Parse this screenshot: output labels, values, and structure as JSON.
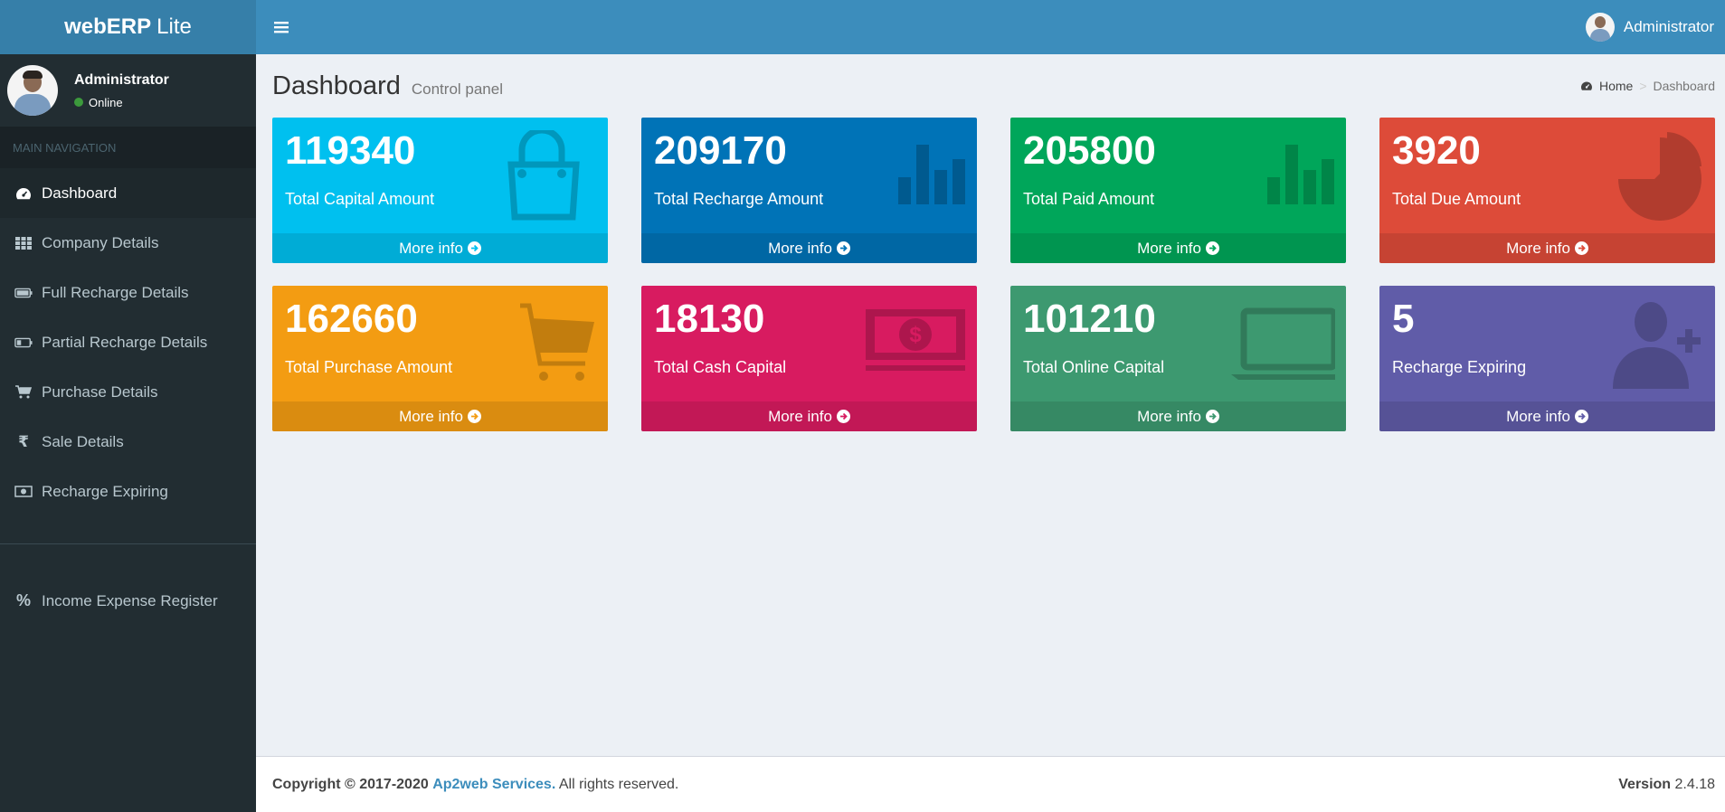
{
  "app": {
    "logo_bold": "webERP",
    "logo_light": "Lite"
  },
  "user": {
    "name": "Administrator",
    "status": "Online"
  },
  "sidebar": {
    "header": "MAIN NAVIGATION",
    "items": [
      {
        "label": "Dashboard",
        "icon": "dashboard-icon"
      },
      {
        "label": "Company Details",
        "icon": "grid-icon"
      },
      {
        "label": "Full Recharge Details",
        "icon": "battery-full-icon"
      },
      {
        "label": "Partial Recharge Details",
        "icon": "battery-partial-icon"
      },
      {
        "label": "Purchase Details",
        "icon": "cart-icon"
      },
      {
        "label": "Sale Details",
        "icon": "rupee-icon"
      },
      {
        "label": "Recharge Expiring",
        "icon": "money-icon"
      }
    ],
    "extra": {
      "label": "Income Expense Register",
      "icon": "percent-icon"
    }
  },
  "topbar": {
    "user": "Administrator"
  },
  "page": {
    "title": "Dashboard",
    "subtitle": "Control panel"
  },
  "breadcrumb": {
    "home": "Home",
    "separator": ">",
    "current": "Dashboard"
  },
  "boxes": [
    {
      "value": "119340",
      "label": "Total Capital Amount",
      "more": "More info",
      "color": "#00c0ef",
      "icon": "shopping-bag-icon"
    },
    {
      "value": "209170",
      "label": "Total Recharge Amount",
      "more": "More info",
      "color": "#0073b7",
      "icon": "bar-chart-icon"
    },
    {
      "value": "205800",
      "label": "Total Paid Amount",
      "more": "More info",
      "color": "#00a65a",
      "icon": "bar-chart-icon"
    },
    {
      "value": "3920",
      "label": "Total Due Amount",
      "more": "More info",
      "color": "#dd4b39",
      "icon": "pie-chart-icon"
    },
    {
      "value": "162660",
      "label": "Total Purchase Amount",
      "more": "More info",
      "color": "#f39c12",
      "icon": "cart-icon"
    },
    {
      "value": "18130",
      "label": "Total Cash Capital",
      "more": "More info",
      "color": "#d81b60",
      "icon": "money-icon"
    },
    {
      "value": "101210",
      "label": "Total Online Capital",
      "more": "More info",
      "color": "#3d9970",
      "icon": "laptop-icon"
    },
    {
      "value": "5",
      "label": "Recharge Expiring",
      "more": "More info",
      "color": "#605ca8",
      "icon": "user-plus-icon"
    }
  ],
  "footer": {
    "copyright": "Copyright © 2017-2020",
    "company": "Ap2web Services.",
    "rights": "All rights reserved.",
    "version_label": "Version",
    "version": "2.4.18"
  }
}
